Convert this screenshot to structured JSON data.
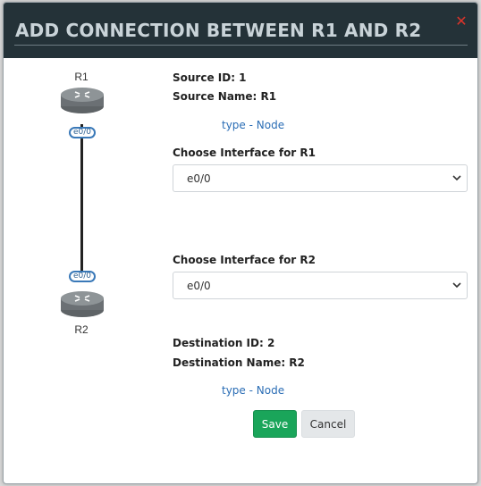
{
  "dialog": {
    "title": "ADD CONNECTION BETWEEN R1 AND R2",
    "close_icon": "close-icon"
  },
  "diagram": {
    "source_router": "R1",
    "destination_router": "R2",
    "source_interface": "e0/0",
    "destination_interface": "e0/0"
  },
  "source": {
    "id_text": "Source ID: 1",
    "name_text": "Source Name: R1",
    "type_text": "type - Node",
    "interface_label": "Choose Interface for R1",
    "interface_value": "e0/0"
  },
  "destination": {
    "interface_label": "Choose Interface for R2",
    "interface_value": "e0/0",
    "id_text": "Destination ID: 2",
    "name_text": "Destination Name: R2",
    "type_text": "type - Node"
  },
  "actions": {
    "save_label": "Save",
    "cancel_label": "Cancel"
  },
  "colors": {
    "titlebar": "#243238",
    "title_text": "#c9d3d8",
    "close": "#d9342b",
    "link": "#2a6db5",
    "save": "#1aa55a",
    "cancel": "#e4e7e9"
  }
}
